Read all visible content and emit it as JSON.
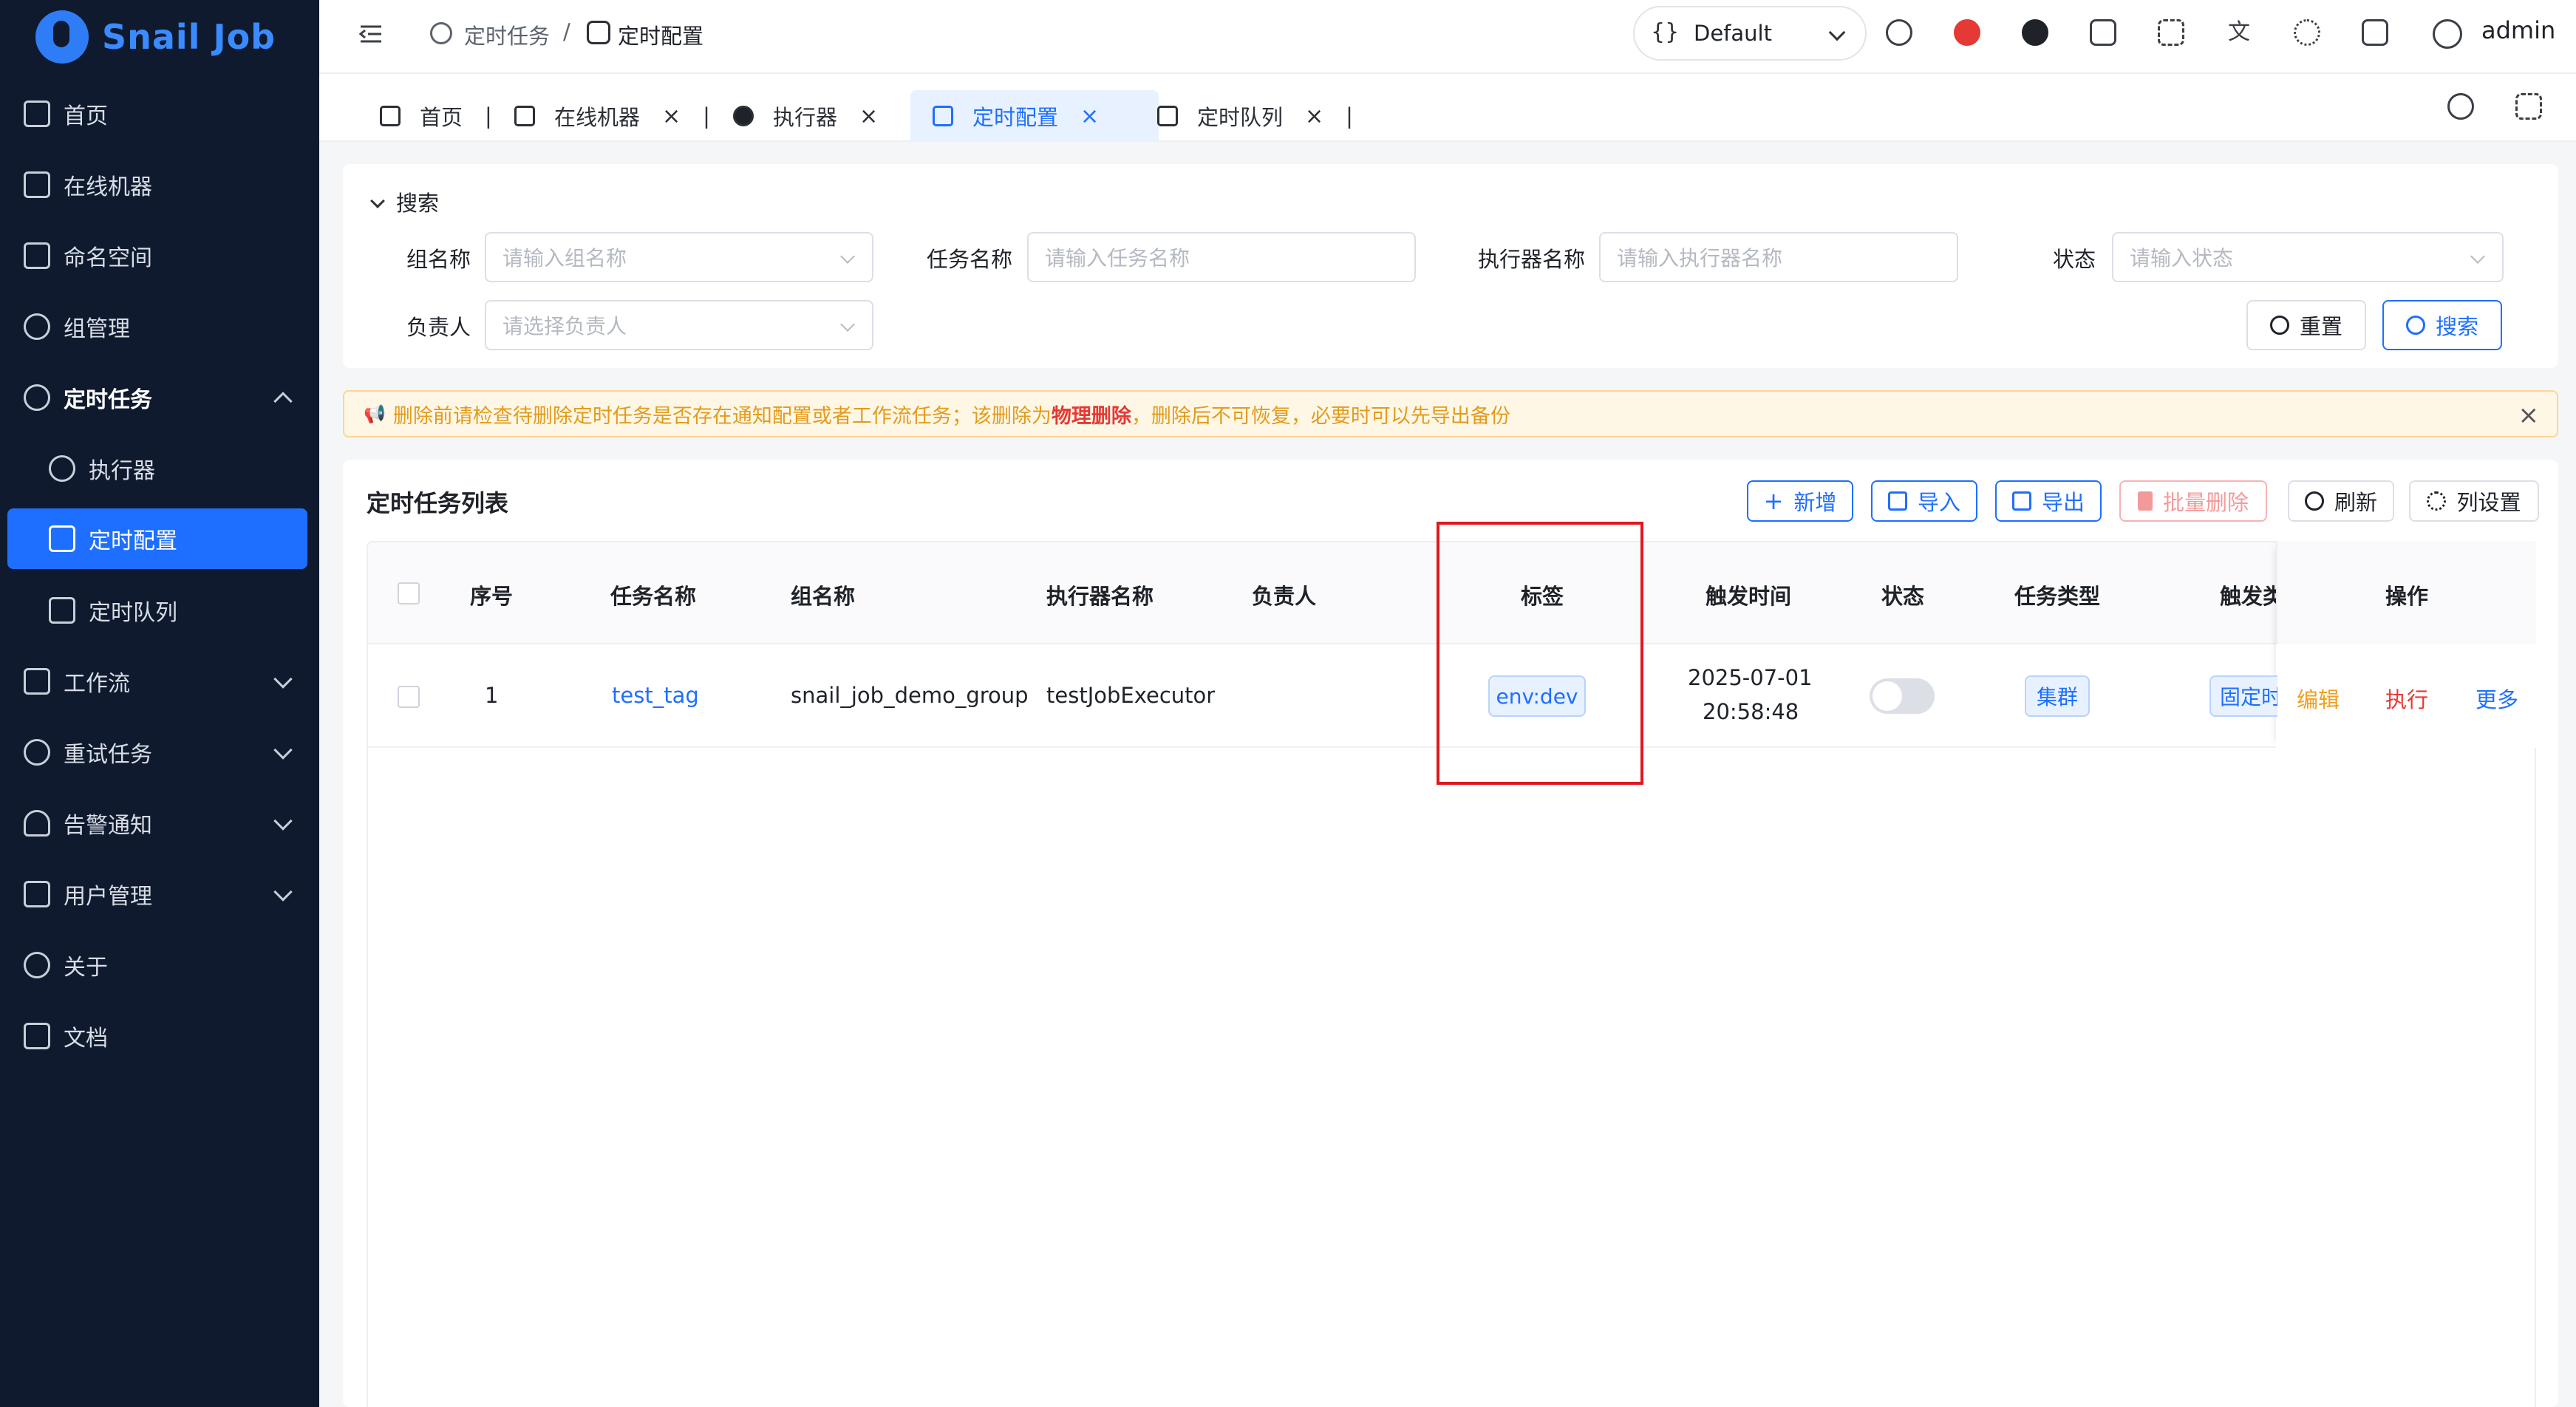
{
  "app": {
    "name": "Snail Job"
  },
  "sidebar": {
    "items": [
      {
        "label": "首页"
      },
      {
        "label": "在线机器"
      },
      {
        "label": "命名空间"
      },
      {
        "label": "组管理"
      },
      {
        "label": "定时任务"
      },
      {
        "label": "执行器"
      },
      {
        "label": "定时配置"
      },
      {
        "label": "定时队列"
      },
      {
        "label": "工作流"
      },
      {
        "label": "重试任务"
      },
      {
        "label": "告警通知"
      },
      {
        "label": "用户管理"
      },
      {
        "label": "关于"
      },
      {
        "label": "文档"
      }
    ]
  },
  "header": {
    "breadcrumb": [
      "定时任务",
      "/",
      "定时配置"
    ],
    "namespace": "Default",
    "user": "admin"
  },
  "tabs": [
    {
      "label": "首页"
    },
    {
      "label": "在线机器"
    },
    {
      "label": "执行器"
    },
    {
      "label": "定时配置"
    },
    {
      "label": "定时队列"
    }
  ],
  "search": {
    "title": "搜索",
    "fields": {
      "group": {
        "label": "组名称",
        "placeholder": "请输入组名称"
      },
      "task": {
        "label": "任务名称",
        "placeholder": "请输入任务名称"
      },
      "executor": {
        "label": "执行器名称",
        "placeholder": "请输入执行器名称"
      },
      "status": {
        "label": "状态",
        "placeholder": "请输入状态"
      },
      "owner": {
        "label": "负责人",
        "placeholder": "请选择负责人"
      }
    },
    "reset": "重置",
    "submit": "搜索"
  },
  "alert": {
    "text_before": "删除前请检查待删除定时任务是否存在通知配置或者工作流任务；该删除为",
    "highlight": "物理删除",
    "text_after": "，删除后不可恢复，必要时可以先导出备份"
  },
  "table": {
    "title": "定时任务列表",
    "actions": {
      "add": "新增",
      "import": "导入",
      "export": "导出",
      "batch_delete": "批量删除",
      "refresh": "刷新",
      "columns": "列设置"
    },
    "headers": [
      "序号",
      "任务名称",
      "组名称",
      "执行器名称",
      "负责人",
      "标签",
      "触发时间",
      "状态",
      "任务类型",
      "触发类",
      "操作"
    ],
    "rows": [
      {
        "index": "1",
        "task_name": "test_tag",
        "group_name": "snail_job_demo_group",
        "executor": "testJobExecutor",
        "owner": "",
        "tag": "env:dev",
        "trigger_date": "2025-07-01",
        "trigger_time": "20:58:48",
        "task_type": "集群",
        "trigger_type": "固定时",
        "ops": {
          "edit": "编辑",
          "run": "执行",
          "more": "更多"
        }
      }
    ]
  },
  "colors": {
    "primary": "#1e6fff",
    "sidebar_bg": "#0f1a2e",
    "warning": "#e39b1b",
    "danger": "#e53935",
    "highlight_box": "#e0181e"
  }
}
